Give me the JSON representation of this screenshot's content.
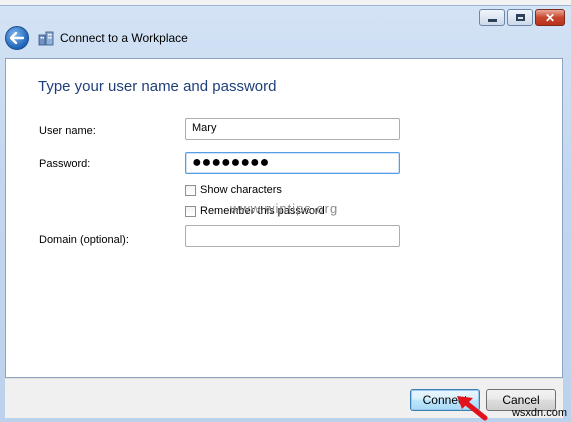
{
  "window": {
    "title": "Connect to a Workplace",
    "controls": {
      "minimize": "minimize",
      "maximize": "maximize",
      "close": "close"
    },
    "close_glyph": "✕"
  },
  "form": {
    "heading": "Type your user name and password",
    "username_label": "User name:",
    "username_value": "Mary",
    "password_label": "Password:",
    "password_value": "●●●●●●●●",
    "show_characters_label": "Show characters",
    "remember_password_label": "Remember this password",
    "domain_label": "Domain (optional):",
    "domain_value": ""
  },
  "watermark": "www.wintips.org",
  "footer": {
    "connect_label": "Connect",
    "cancel_label": "Cancel"
  },
  "corner_tag": "wsxdn.com",
  "colors": {
    "heading": "#1e3f7a",
    "arrow": "#e0121b",
    "focus_border": "#569de5"
  }
}
